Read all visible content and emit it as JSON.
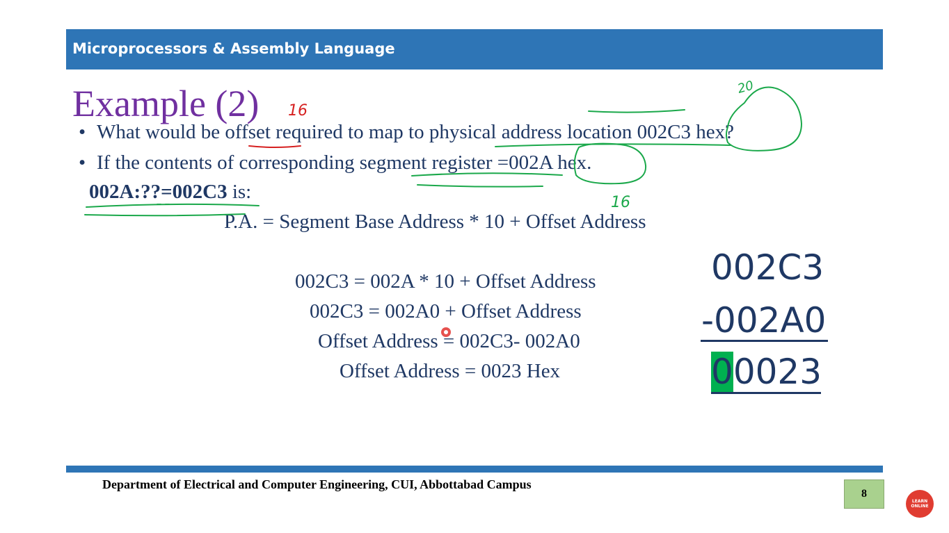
{
  "header": {
    "title": "Microprocessors & Assembly Language"
  },
  "slide": {
    "title": "Example (2)",
    "bullets": [
      {
        "symbol": "•",
        "text": "What would be offset required to map to physical address location 002C3 hex?"
      },
      {
        "symbol": "•",
        "text": "If the contents of corresponding segment register =002A hex."
      }
    ],
    "expression": {
      "bold": "002A:??=002C3",
      "rest": " is:"
    },
    "formula": "P.A. = Segment Base Address * 10 + Offset Address",
    "steps": [
      "002C3 = 002A * 10 + Offset Address",
      "002C3 = 002A0 + Offset Address",
      "Offset Address = 002C3- 002A0",
      "Offset Address = 0023 Hex"
    ],
    "subtraction": {
      "minuend": "002C3",
      "subtrahend": "-002A0",
      "result_highlight": "0",
      "result_rest": "0023"
    }
  },
  "annotations": {
    "note_16_title": "16",
    "note_16_register": "16",
    "note_20": "20"
  },
  "footer": {
    "department": "Department of Electrical and Computer Engineering, CUI, Abbottabad Campus",
    "page_number": "8"
  },
  "logo": {
    "line1": "LEARN",
    "line2": "ONLINE"
  },
  "colors": {
    "header_bar": "#2e75b6",
    "title": "#7030a0",
    "body_text": "#1f3864",
    "ink_green": "#1aa84a",
    "ink_red": "#d62020",
    "highlight": "#00b050",
    "page_box": "#a9d18e"
  }
}
